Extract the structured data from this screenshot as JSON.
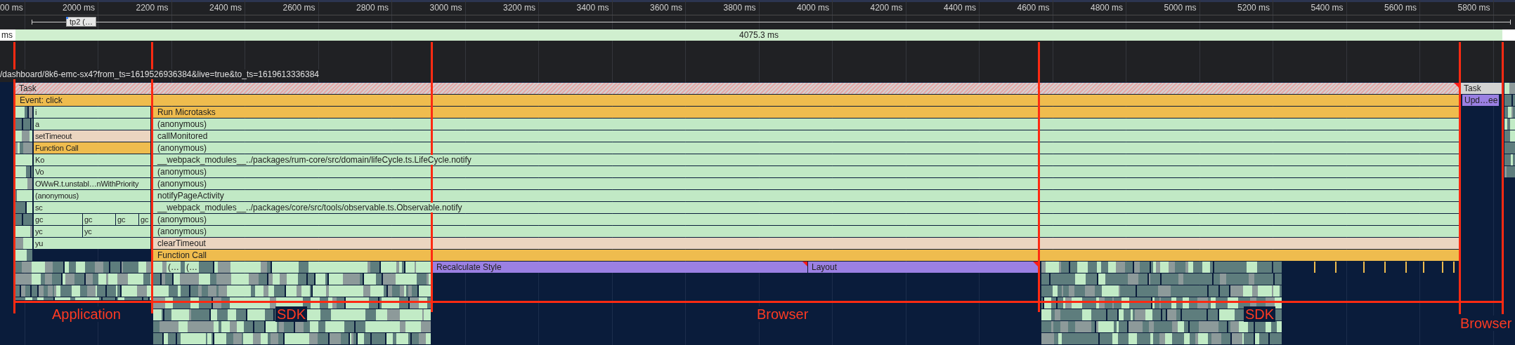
{
  "ruler": {
    "ticks": [
      "00 ms",
      "2000 ms",
      "2200 ms",
      "2400 ms",
      "2600 ms",
      "2800 ms",
      "3000 ms",
      "3200 ms",
      "3400 ms",
      "3600 ms",
      "3800 ms",
      "4000 ms",
      "4200 ms",
      "4400 ms",
      "4600 ms",
      "4800 ms",
      "5000 ms",
      "5200 ms",
      "5400 ms",
      "5600 ms",
      "5800 ms"
    ]
  },
  "marker": {
    "label": "tp2 (…"
  },
  "interaction": {
    "unit": "ms",
    "duration": "4075.3 ms"
  },
  "url": "/dashboard/8k6-emc-sx4?from_ts=1619526936384&live=true&to_ts=1619613336384",
  "task": {
    "label": "Task"
  },
  "event": {
    "label": "Event: click",
    "kind": "event"
  },
  "stack": [
    {
      "app": [
        {
          "label": "i",
          "kind": "script"
        }
      ],
      "sdk": {
        "label": "Run Microtasks",
        "kind": "event"
      }
    },
    {
      "app": [
        {
          "label": "a",
          "kind": "script"
        }
      ],
      "sdk": {
        "label": "(anonymous)",
        "kind": "script"
      }
    },
    {
      "app": [
        {
          "label": "setTimeout",
          "kind": "timer"
        }
      ],
      "sdk": {
        "label": "callMonitored",
        "kind": "script"
      }
    },
    {
      "app": [
        {
          "label": "Function Call",
          "kind": "event"
        }
      ],
      "sdk": {
        "label": "(anonymous)",
        "kind": "script"
      }
    },
    {
      "app": [
        {
          "label": "Ko",
          "kind": "script"
        }
      ],
      "sdk": {
        "label": "__webpack_modules__../packages/rum-core/src/domain/lifeCycle.ts.LifeCycle.notify",
        "kind": "script"
      }
    },
    {
      "app": [
        {
          "label": "Vo",
          "kind": "script"
        }
      ],
      "sdk": {
        "label": "(anonymous)",
        "kind": "script"
      }
    },
    {
      "app": [
        {
          "label": "OWwR.t.unstabl…nWithPriority",
          "kind": "script"
        }
      ],
      "sdk": {
        "label": "(anonymous)",
        "kind": "script"
      }
    },
    {
      "app": [
        {
          "label": "(anonymous)",
          "kind": "script"
        }
      ],
      "sdk": {
        "label": "notifyPageActivity",
        "kind": "script"
      }
    },
    {
      "app": [
        {
          "label": "sc",
          "kind": "script"
        }
      ],
      "sdk": {
        "label": "__webpack_modules__../packages/core/src/tools/observable.ts.Observable.notify",
        "kind": "script"
      }
    },
    {
      "app": [
        {
          "label": "gc",
          "kind": "script"
        },
        {
          "label": "gc",
          "kind": "script"
        },
        {
          "label": "gc",
          "kind": "script"
        },
        {
          "label": "gc",
          "kind": "script"
        }
      ],
      "sdk": {
        "label": "(anonymous)",
        "kind": "script"
      }
    },
    {
      "app": [
        {
          "label": "yc",
          "kind": "script"
        },
        {
          "label": "yc",
          "kind": "script"
        }
      ],
      "sdk": {
        "label": "(anonymous)",
        "kind": "script"
      }
    },
    {
      "app": [
        {
          "label": "yu",
          "kind": "script"
        }
      ],
      "sdk": {
        "label": "clearTimeout",
        "kind": "timer"
      }
    },
    {
      "sdk": {
        "label": "Function Call",
        "kind": "event"
      }
    }
  ],
  "sdk_children": [
    {
      "label": "(…"
    },
    {
      "label": "(…"
    }
  ],
  "rendering": [
    {
      "label": "Recalculate Style",
      "kind": "render"
    },
    {
      "label": "Layout",
      "kind": "render"
    }
  ],
  "next_task": {
    "label": "Task"
  },
  "next_event": {
    "label": "Upd…ee",
    "kind": "render"
  },
  "regions": [
    {
      "label": "Application"
    },
    {
      "label": "SDK"
    },
    {
      "label": "Browser"
    },
    {
      "label": "SDK"
    },
    {
      "label": "Browser"
    }
  ]
}
